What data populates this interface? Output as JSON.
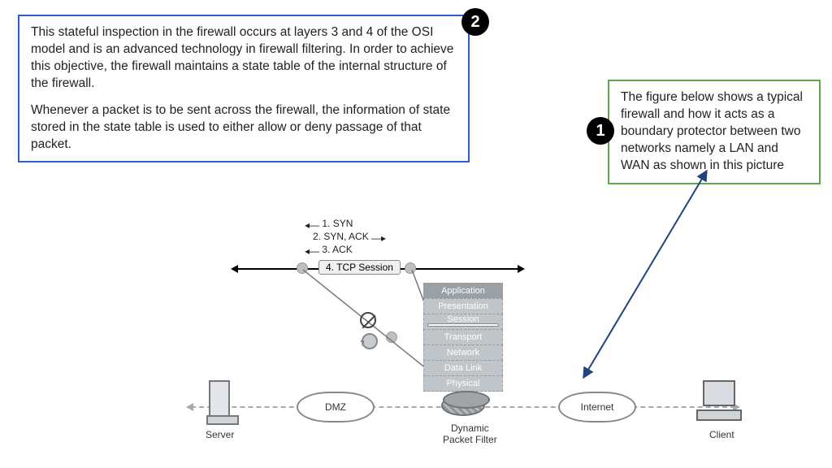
{
  "callouts": {
    "callout2": {
      "number": "2",
      "para1": "This stateful inspection in the firewall occurs at layers 3 and 4 of the OSI model and is an advanced technology in firewall filtering. In order to achieve this objective, the firewall maintains a state table of the internal structure of the firewall.",
      "para2": "Whenever a packet is to be sent across the firewall, the information of state stored in the state table is used to either allow or deny passage of that packet."
    },
    "callout1": {
      "number": "1",
      "text": "The figure below shows a typical firewall and how it acts as a boundary protector between two networks namely a LAN and WAN as shown in this picture"
    }
  },
  "diagram": {
    "handshake": {
      "step1": "1. SYN",
      "step2": "2. SYN, ACK",
      "step3": "3. ACK",
      "step4": "4. TCP Session"
    },
    "osi": {
      "l7": "Application",
      "l6": "Presentation",
      "l5": "Session",
      "l4": "Transport",
      "l3": "Network",
      "l2": "Data Link",
      "l1": "Physical"
    },
    "labels": {
      "server": "Server",
      "dmz": "DMZ",
      "filter1": "Dynamic",
      "filter2": "Packet Filter",
      "internet": "Internet",
      "client": "Client"
    }
  },
  "colors": {
    "blueBorder": "#2b5fce",
    "greenBorder": "#5fa74a",
    "badge": "#000000",
    "arrow": "#22437f"
  }
}
